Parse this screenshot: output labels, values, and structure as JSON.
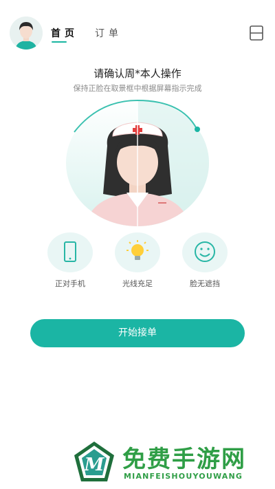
{
  "header": {
    "tabs": [
      {
        "label": "首页",
        "active": true
      },
      {
        "label": "订单",
        "active": false
      }
    ],
    "accent_color": "#18b5a1",
    "scan_icon": "scan-icon"
  },
  "instructions": {
    "title": "请确认周*本人操作",
    "subtitle": "保持正脸在取景框中根据屏幕指示完成"
  },
  "tips": [
    {
      "icon": "phone-icon",
      "label": "正对手机"
    },
    {
      "icon": "lightbulb-icon",
      "label": "光线充足"
    },
    {
      "icon": "smile-icon",
      "label": "脸无遮挡"
    }
  ],
  "actions": {
    "start_label": "开始接单",
    "button_color": "#1bb5a4"
  },
  "watermark": {
    "title": "免费手游网",
    "subtitle": "MIANFEISHOUYOUWANG",
    "logo_letter": "M",
    "color": "#2f9e46"
  }
}
